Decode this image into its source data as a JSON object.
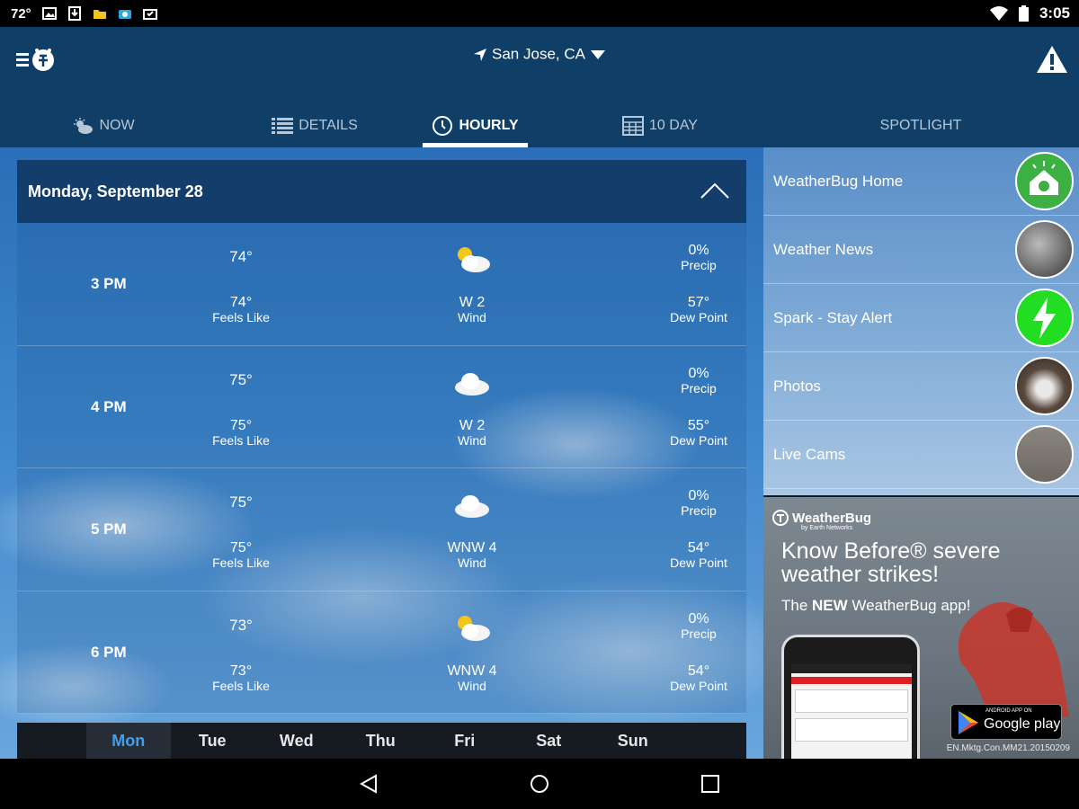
{
  "status_bar": {
    "temperature": "72°",
    "time": "3:05",
    "left_icons": [
      "image-icon",
      "download-icon",
      "folder-icon",
      "camera-icon",
      "briefcase-icon"
    ],
    "right_icons": [
      "wifi-icon",
      "battery-icon"
    ]
  },
  "header": {
    "location": "San Jose, CA",
    "menu_icon": "weatherbug-menu-icon",
    "alert_icon": "alert-icon"
  },
  "tabs": [
    {
      "label": "NOW",
      "icon": "sun-cloud-icon",
      "active": false
    },
    {
      "label": "DETAILS",
      "icon": "list-icon",
      "active": false
    },
    {
      "label": "HOURLY",
      "icon": "clock-icon",
      "active": true
    },
    {
      "label": "10 DAY",
      "icon": "calendar-icon",
      "active": false
    },
    {
      "label": "SPOTLIGHT",
      "icon": "",
      "active": false
    }
  ],
  "hourly": {
    "date": "Monday, September 28",
    "rows": [
      {
        "time": "3 PM",
        "temp": "74°",
        "feels": "74°",
        "feels_label": "Feels Like",
        "wind": "W 2",
        "wind_label": "Wind",
        "precip": "0%",
        "precip_label": "Precip",
        "dew": "57°",
        "dew_label": "Dew Point",
        "icon": "partly-sunny-icon"
      },
      {
        "time": "4 PM",
        "temp": "75°",
        "feels": "75°",
        "feels_label": "Feels Like",
        "wind": "W 2",
        "wind_label": "Wind",
        "precip": "0%",
        "precip_label": "Precip",
        "dew": "55°",
        "dew_label": "Dew Point",
        "icon": "cloud-icon"
      },
      {
        "time": "5 PM",
        "temp": "75°",
        "feels": "75°",
        "feels_label": "Feels Like",
        "wind": "WNW 4",
        "wind_label": "Wind",
        "precip": "0%",
        "precip_label": "Precip",
        "dew": "54°",
        "dew_label": "Dew Point",
        "icon": "cloud-icon"
      },
      {
        "time": "6 PM",
        "temp": "73°",
        "feels": "73°",
        "feels_label": "Feels Like",
        "wind": "WNW 4",
        "wind_label": "Wind",
        "precip": "0%",
        "precip_label": "Precip",
        "dew": "54°",
        "dew_label": "Dew Point",
        "icon": "partly-sunny-icon"
      }
    ]
  },
  "days": [
    {
      "label": "Mon",
      "active": true
    },
    {
      "label": "Tue",
      "active": false
    },
    {
      "label": "Wed",
      "active": false
    },
    {
      "label": "Thu",
      "active": false
    },
    {
      "label": "Fri",
      "active": false
    },
    {
      "label": "Sat",
      "active": false
    },
    {
      "label": "Sun",
      "active": false
    }
  ],
  "sidebar": {
    "items": [
      {
        "label": "WeatherBug Home",
        "thumb": "weatherbug-home-icon"
      },
      {
        "label": "Weather News",
        "thumb": "news-thumbnail"
      },
      {
        "label": "Spark - Stay Alert",
        "thumb": "lightning-icon"
      },
      {
        "label": "Photos",
        "thumb": "photo-thumbnail"
      },
      {
        "label": "Live Cams",
        "thumb": "cam-thumbnail"
      }
    ]
  },
  "ad": {
    "brand": "WeatherBug",
    "brand_sub": "by Earth Networks",
    "headline": "Know Before® severe weather strikes!",
    "tagline_pre": "The ",
    "tagline_bold": "NEW",
    "tagline_post": " WeatherBug app!",
    "store_small": "ANDROID APP ON",
    "store_big": "Google play",
    "code": "EN.Mktg.Con.MM21.20150209"
  },
  "colors": {
    "appbar": "#0f3e66",
    "active_day": "#3fa0ee",
    "spark_green": "#22dd22",
    "home_green": "#3cb043"
  }
}
